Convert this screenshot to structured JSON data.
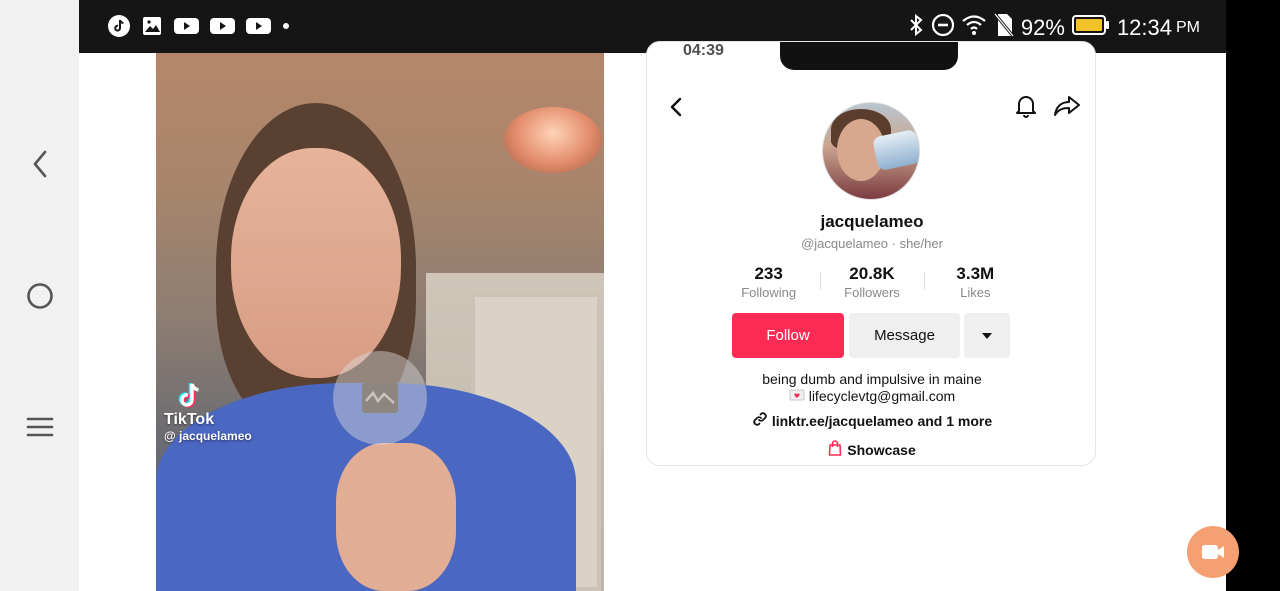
{
  "status_bar": {
    "left_icons": [
      "tiktok-icon",
      "image-icon",
      "youtube-icon",
      "youtube-icon",
      "youtube-icon"
    ],
    "battery": "92%",
    "time": "12:34",
    "period": "PM"
  },
  "nav_rail": {
    "icons": [
      "back-chevron-icon",
      "home-circle-icon",
      "menu-icon"
    ]
  },
  "video": {
    "brand": "TikTok",
    "handle": "@ jacquelameo"
  },
  "profile": {
    "display_name": "jacquelameo",
    "handle": "@jacquelameo",
    "pronouns": "she/her",
    "stats": [
      {
        "value": "233",
        "label": "Following"
      },
      {
        "value": "20.8K",
        "label": "Followers"
      },
      {
        "value": "3.3M",
        "label": "Likes"
      }
    ],
    "follow_label": "Follow",
    "message_label": "Message",
    "bio_line1": "being dumb and impulsive in maine",
    "bio_email": "lifecyclevtg@gmail.com",
    "link_text": "linktr.ee/jacquelameo",
    "link_more": "and 1 more",
    "showcase_label": "Showcase"
  },
  "colors": {
    "follow_button": "#fe2c55",
    "fab": "#f5a073"
  }
}
